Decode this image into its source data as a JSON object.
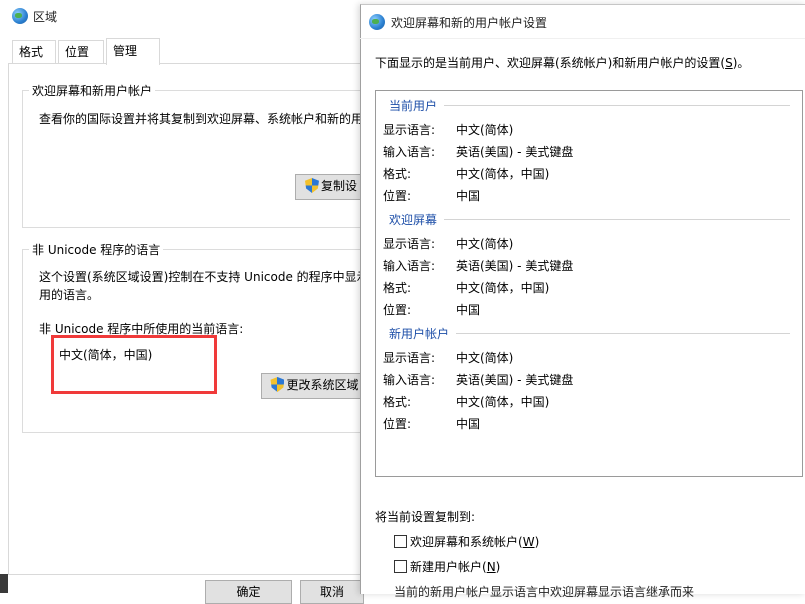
{
  "region_window": {
    "title": "区域",
    "tabs": [
      "格式",
      "位置",
      "管理"
    ],
    "active_tab": "管理",
    "welcome_group": {
      "title": "欢迎屏幕和新用户帐户",
      "description": "查看你的国际设置并将其复制到欢迎屏幕、系统帐户和新的用",
      "copy_button": "复制设"
    },
    "unicode_group": {
      "title": "非 Unicode 程序的语言",
      "description_line1": "这个设置(系统区域设置)控制在不支持 Unicode 的程序中显示",
      "description_line2": "用的语言。",
      "current_label": "非 Unicode 程序中所使用的当前语言:",
      "current_value": "中文(简体，中国)",
      "change_button": "更改系统区域"
    },
    "ok_button": "确定",
    "cancel_button": "取消"
  },
  "dialog": {
    "title": "欢迎屏幕和新的用户帐户设置",
    "intro": "下面显示的是当前用户、欢迎屏幕(系统帐户)和新用户帐户的设置(",
    "intro_key": "S",
    "intro_end": ")。",
    "sections": [
      {
        "header": "当前用户",
        "rows": [
          {
            "label": "显示语言:",
            "value": "中文(简体)"
          },
          {
            "label": "输入语言:",
            "value": "英语(美国) - 美式键盘"
          },
          {
            "label": "格式:",
            "value": "中文(简体，中国)"
          },
          {
            "label": "位置:",
            "value": "中国"
          }
        ]
      },
      {
        "header": "欢迎屏幕",
        "rows": [
          {
            "label": "显示语言:",
            "value": "中文(简体)"
          },
          {
            "label": "输入语言:",
            "value": "英语(美国) - 美式键盘"
          },
          {
            "label": "格式:",
            "value": "中文(简体，中国)"
          },
          {
            "label": "位置:",
            "value": "中国"
          }
        ]
      },
      {
        "header": "新用户帐户",
        "rows": [
          {
            "label": "显示语言:",
            "value": "中文(简体)"
          },
          {
            "label": "输入语言:",
            "value": "英语(美国) - 美式键盘"
          },
          {
            "label": "格式:",
            "value": "中文(简体，中国)"
          },
          {
            "label": "位置:",
            "value": "中国"
          }
        ]
      }
    ],
    "copy_to_label": "将当前设置复制到:",
    "checkbox_welcome": {
      "text": "欢迎屏幕和系统帐户(",
      "key": "W",
      "end": ")",
      "checked": false
    },
    "checkbox_new_user": {
      "text": "新建用户帐户(",
      "key": "N",
      "end": ")",
      "checked": false
    },
    "footer_note": "当前的新用户帐户显示语言中欢迎屏幕显示语言继承而来"
  }
}
